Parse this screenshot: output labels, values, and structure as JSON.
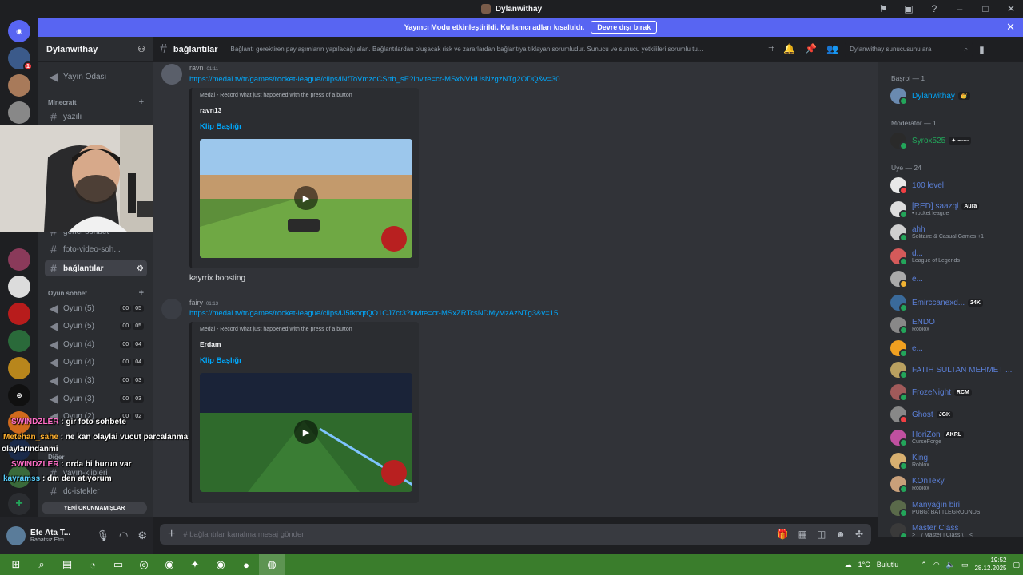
{
  "window": {
    "title": "Dylanwithay"
  },
  "banner": {
    "text": "Yayıncı Modu etkinleştirildi. Kullanıcı adları kısaltıldı.",
    "button": "Devre dışı bırak"
  },
  "guild": {
    "name": "Dylanwithay"
  },
  "channels": {
    "top": "Yayın Odası",
    "cat_minecraft": "Minecraft",
    "yazili": "yazılı",
    "genel": "genel sohbet",
    "foto": "foto-video-soh...",
    "baglantilar": "bağlantılar",
    "cat_oyun": "Oyun sohbet",
    "voice": [
      {
        "label": "Oyun (5)",
        "a": "00",
        "b": "05"
      },
      {
        "label": "Oyun (5)",
        "a": "00",
        "b": "05"
      },
      {
        "label": "Oyun (4)",
        "a": "00",
        "b": "04"
      },
      {
        "label": "Oyun (4)",
        "a": "00",
        "b": "04"
      },
      {
        "label": "Oyun (3)",
        "a": "00",
        "b": "03"
      },
      {
        "label": "Oyun (3)",
        "a": "00",
        "b": "03"
      },
      {
        "label": "Oyun (2)",
        "a": "00",
        "b": "02"
      }
    ],
    "cat_diger": "Diğer",
    "klipler": "yayın-klipleri",
    "istekler": "dc-istekler",
    "new_unread": "YENİ OKUNMAMIŞLAR"
  },
  "user": {
    "name": "Efe Ata T...",
    "status": "Rahatsız Etm..."
  },
  "chat_header": {
    "channel": "bağlantılar",
    "topic": "Bağlantı gerektiren paylaşımların yapılacağı alan. Bağlantılardan oluşacak risk ve zararlardan bağlantıya tıklayan sorumludur. Sunucu ve sunucu yetkilileri sorumlu tu...",
    "search": "Dylanwithay sunucusunu ara"
  },
  "messages": [
    {
      "author": "ravn",
      "time": "01:11",
      "link": "https://medal.tv/tr/games/rocket-league/clips/lNfToVmzoCSrtb_sE?invite=cr-MSxNVHUsNzgzNTg2ODQ&v=30",
      "provider": "Medal - Record what just happened with the press of a button",
      "embed_author": "ravn13",
      "embed_title": "Klip Başlığı"
    },
    {
      "text": "kayrrix boosting"
    },
    {
      "author": "fairy",
      "time": "01:13",
      "link": "https://medal.tv/tr/games/rocket-league/clips/lJ5tkoqtQO1CJ7ct3?invite=cr-MSxZRTcsNDMyMzAzNTg3&v=15",
      "provider": "Medal - Record what just happened with the press of a button",
      "embed_author": "Erdam",
      "embed_title": "Klip Başlığı"
    }
  ],
  "composer": {
    "placeholder": "# bağlantılar kanalına mesaj gönder"
  },
  "members": {
    "cat_basrol": "Başrol — 1",
    "cat_moderator": "Moderatör — 1",
    "cat_uye": "Üye — 24",
    "list": [
      {
        "name": "Dylanwithay",
        "activity": "",
        "color": "#00a8fc",
        "tag": "👑"
      },
      {
        "name": "Syrox525",
        "activity": "",
        "color": "#23a55a",
        "tag": "✦ ⁓⁓"
      },
      {
        "name": "100 level",
        "activity": "",
        "color": "#5b7fd6",
        "tag": ""
      },
      {
        "name": "[RED] saazql",
        "activity": "• rocket league",
        "color": "#5b7fd6",
        "tag": "Aura"
      },
      {
        "name": "ahh",
        "activity": "Solitaire & Casual Games +1",
        "color": "#5b7fd6",
        "tag": ""
      },
      {
        "name": "d...",
        "activity": "League of Legends",
        "color": "#5b7fd6",
        "tag": ""
      },
      {
        "name": "e...",
        "activity": "",
        "color": "#5b7fd6",
        "tag": ""
      },
      {
        "name": "Emirccanexd...",
        "activity": "",
        "color": "#5b7fd6",
        "tag": "24K"
      },
      {
        "name": "ENDO",
        "activity": "Roblox",
        "color": "#5b7fd6",
        "tag": ""
      },
      {
        "name": "e...",
        "activity": "",
        "color": "#5b7fd6",
        "tag": ""
      },
      {
        "name": "FATİH SULTAN MEHMET ...",
        "activity": "",
        "color": "#5b7fd6",
        "tag": ""
      },
      {
        "name": "FrozeNight",
        "activity": "",
        "color": "#5b7fd6",
        "tag": "RCM"
      },
      {
        "name": "Ghost",
        "activity": "",
        "color": "#5b7fd6",
        "tag": "JGK"
      },
      {
        "name": "HoriZon",
        "activity": "CurseForge",
        "color": "#5b7fd6",
        "tag": "AKRL"
      },
      {
        "name": "King",
        "activity": "Roblox",
        "color": "#5b7fd6",
        "tag": ""
      },
      {
        "name": "KOnTexy",
        "activity": "Roblox",
        "color": "#5b7fd6",
        "tag": ""
      },
      {
        "name": "Manyağın biri",
        "activity": "PUBG: BATTLEGROUNDS",
        "color": "#5b7fd6",
        "tag": ""
      },
      {
        "name": "Master Class",
        "activity": ">__/ Master | Class \\__<",
        "color": "#5b7fd6",
        "tag": ""
      }
    ]
  },
  "overlay_chat": [
    {
      "user": "SWINDZLER",
      "text": ": gir foto sohbete",
      "color": "#ff6ec7"
    },
    {
      "user": "Metehan_sahe",
      "text": ": ne kan olaylai vucut parcalanma",
      "color": "#ffb02e"
    },
    {
      "user": "",
      "text": "olaylarındanmi",
      "color": "#ffffff"
    },
    {
      "user": "SWINDZLER",
      "text": ": orda bi burun var",
      "color": "#ff6ec7"
    },
    {
      "user": "kayramss",
      "text": ": dm den atıyorum",
      "color": "#5ad0ff"
    }
  ],
  "taskbar": {
    "weather": "1°C",
    "weather_text": "Bulutlu",
    "time": "19:52",
    "date": "28.12.2025"
  }
}
